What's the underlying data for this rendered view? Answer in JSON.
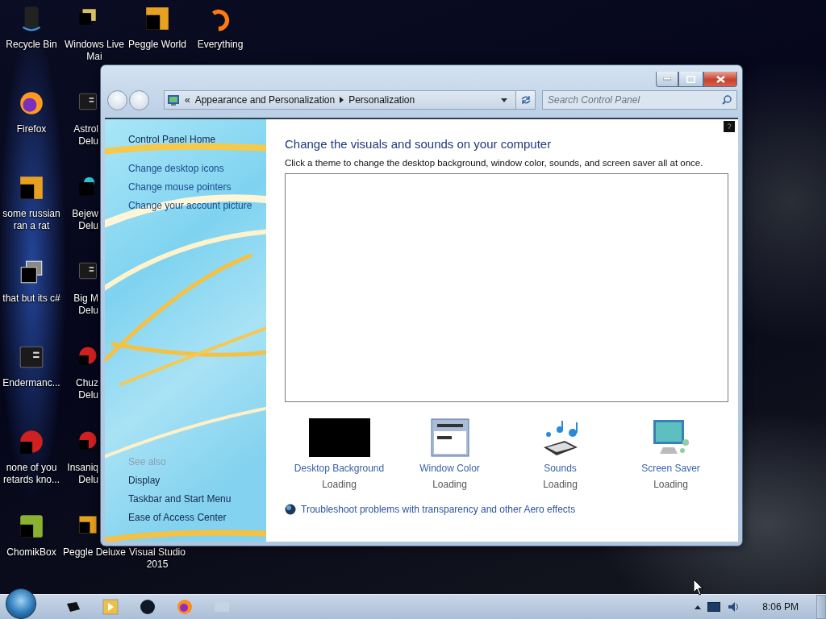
{
  "desktop": {
    "columns": [
      [
        {
          "lines": [
            "Recycle Bin"
          ],
          "kind": "bin",
          "cut": false
        },
        {
          "lines": [
            "Firefox"
          ],
          "kind": "fox",
          "cut": false
        },
        {
          "lines": [
            "some russian",
            "ran a rat"
          ],
          "kind": "orange",
          "cut": false
        },
        {
          "lines": [
            "that but its c#"
          ],
          "kind": "stack",
          "cut": false
        },
        {
          "lines": [
            "Endermanc..."
          ],
          "kind": "dark",
          "cut": false
        },
        {
          "lines": [
            "none of you",
            "retards kno..."
          ],
          "kind": "red",
          "cut": false
        },
        {
          "lines": [
            "ChomikBox"
          ],
          "kind": "green",
          "cut": false
        }
      ],
      [
        {
          "lines": [
            "Windows Live",
            "Mai"
          ],
          "kind": "mail",
          "cut": false
        },
        {
          "lines": [
            "Astrol",
            "Delu"
          ],
          "kind": "dark",
          "cut": true
        },
        {
          "lines": [
            "Bejew",
            "Delu"
          ],
          "kind": "teal",
          "cut": true
        },
        {
          "lines": [
            "Big M",
            "Delu"
          ],
          "kind": "dark",
          "cut": true
        },
        {
          "lines": [
            "Chuz",
            "Delu"
          ],
          "kind": "red",
          "cut": true
        },
        {
          "lines": [
            "Insaniq",
            "Delu"
          ],
          "kind": "red",
          "cut": true
        },
        {
          "lines": [
            "Peggle Deluxe"
          ],
          "kind": "orange",
          "cut": false
        }
      ],
      [
        {
          "lines": [
            "Peggle World"
          ],
          "kind": "orange",
          "cut": false
        },
        {
          "lines": [
            "Visual Studio",
            "2015"
          ],
          "kind": "covered",
          "cut": false
        }
      ],
      [
        {
          "lines": [
            "Everything"
          ],
          "kind": "ring",
          "cut": false
        }
      ]
    ]
  },
  "window": {
    "address_bar": {
      "overflow": "«",
      "crumbs": [
        "Appearance and Personalization",
        "Personalization"
      ]
    },
    "search": {
      "placeholder": "Search Control Panel"
    },
    "sidebar": {
      "links": [
        {
          "label": "Control Panel Home",
          "kind": "home"
        },
        {
          "label": "Change desktop icons",
          "kind": "task"
        },
        {
          "label": "Change mouse pointers",
          "kind": "task"
        },
        {
          "label": "Change your account picture",
          "kind": "task"
        }
      ],
      "see_also_title": "See also",
      "see_also": [
        "Display",
        "Taskbar and Start Menu",
        "Ease of Access Center"
      ]
    },
    "main": {
      "title": "Change the visuals and sounds on your computer",
      "description": "Click a theme to change the desktop background, window color, sounds, and screen saver all at once.",
      "settings": [
        {
          "label": "Desktop Background",
          "status": "Loading",
          "kind": "background"
        },
        {
          "label": "Window Color",
          "status": "Loading",
          "kind": "color"
        },
        {
          "label": "Sounds",
          "status": "Loading",
          "kind": "sounds"
        },
        {
          "label": "Screen Saver",
          "status": "Loading",
          "kind": "saver"
        }
      ],
      "troubleshoot_link": "Troubleshoot problems with transparency and other Aero effects"
    }
  },
  "taskbar": {
    "pinned": [
      {
        "kind": "dark"
      },
      {
        "kind": "media"
      },
      {
        "kind": "ball"
      },
      {
        "kind": "fox"
      },
      {
        "kind": "faded"
      }
    ],
    "clock": "8:06 PM"
  }
}
